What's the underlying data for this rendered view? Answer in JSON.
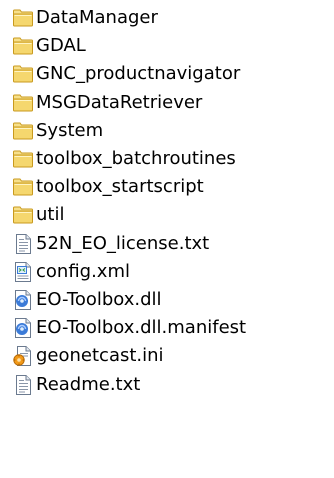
{
  "items": [
    {
      "name": "DataManager",
      "type": "folder",
      "icon": "folder-icon"
    },
    {
      "name": "GDAL",
      "type": "folder",
      "icon": "folder-icon"
    },
    {
      "name": "GNC_productnavigator",
      "type": "folder",
      "icon": "folder-icon"
    },
    {
      "name": "MSGDataRetriever",
      "type": "folder",
      "icon": "folder-icon"
    },
    {
      "name": "System",
      "type": "folder",
      "icon": "folder-icon"
    },
    {
      "name": "toolbox_batchroutines",
      "type": "folder",
      "icon": "folder-icon"
    },
    {
      "name": "toolbox_startscript",
      "type": "folder",
      "icon": "folder-icon"
    },
    {
      "name": "util",
      "type": "folder",
      "icon": "folder-icon"
    },
    {
      "name": "52N_EO_license.txt",
      "type": "text",
      "icon": "text-file-icon"
    },
    {
      "name": "config.xml",
      "type": "xml",
      "icon": "xml-file-icon"
    },
    {
      "name": "EO-Toolbox.dll",
      "type": "dll",
      "icon": "dll-file-icon"
    },
    {
      "name": "EO-Toolbox.dll.manifest",
      "type": "dll",
      "icon": "dll-file-icon"
    },
    {
      "name": "geonetcast.ini",
      "type": "ini",
      "icon": "ini-file-icon"
    },
    {
      "name": "Readme.txt",
      "type": "text",
      "icon": "text-file-icon"
    }
  ],
  "colors": {
    "folder_fill": "#f5d76e",
    "folder_edge": "#c99a1e",
    "file_edge": "#6b7a8f",
    "dll_blue": "#3b7bd8",
    "ini_orange": "#f29a1a"
  }
}
